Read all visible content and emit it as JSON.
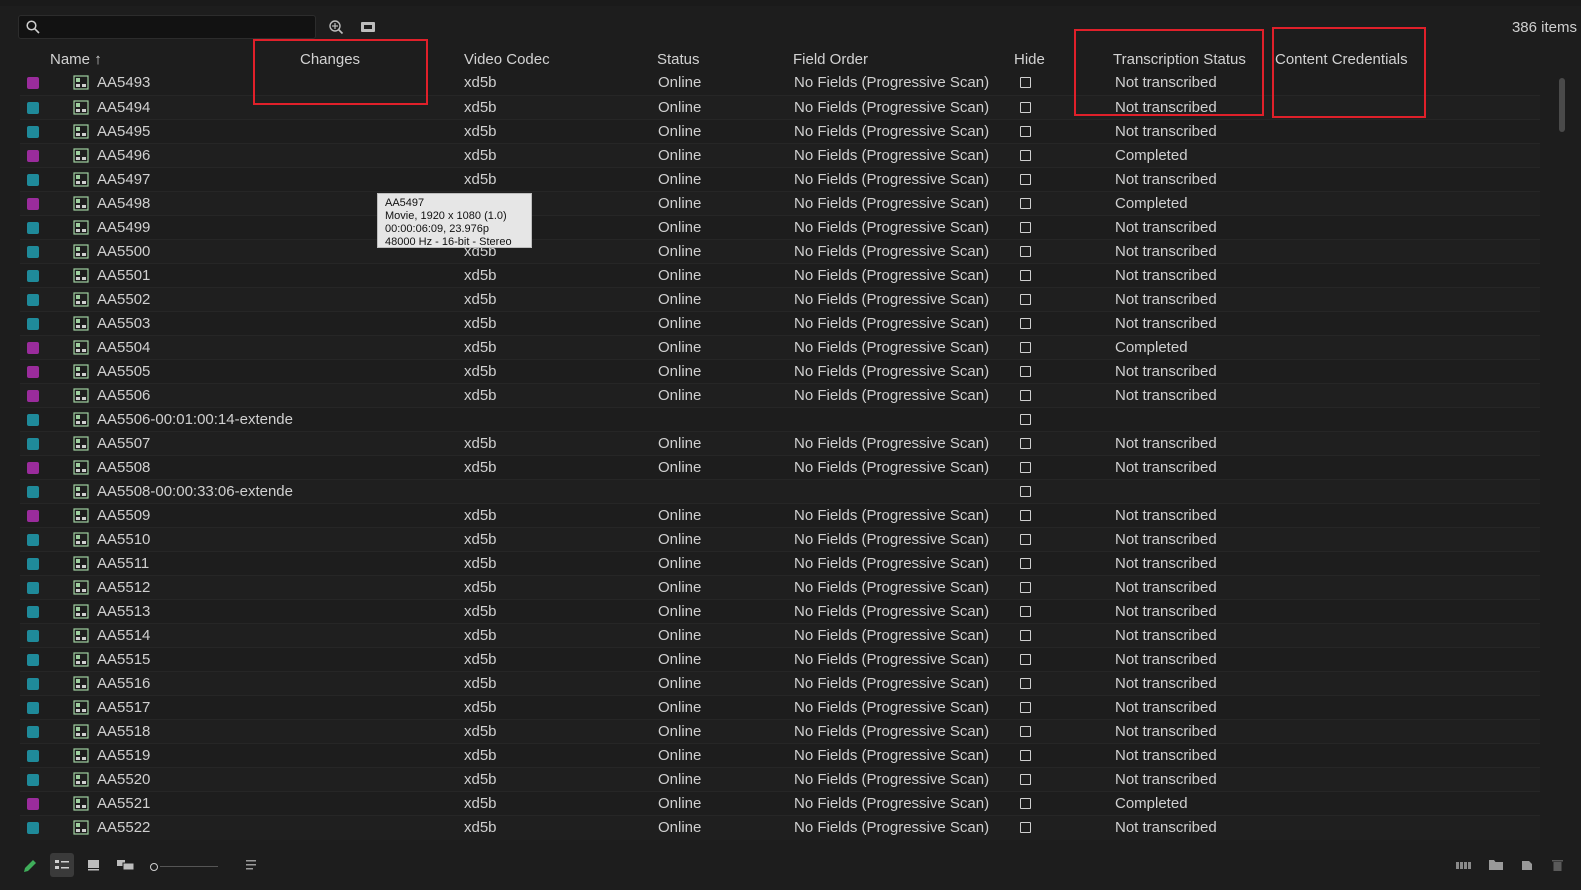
{
  "toolbar": {
    "search_value": "",
    "item_count": "386 items"
  },
  "columns": {
    "name": "Name",
    "changes": "Changes",
    "video_codec": "Video Codec",
    "status": "Status",
    "field_order": "Field Order",
    "hide": "Hide",
    "transcription_status": "Transcription Status",
    "content_credentials": "Content Credentials"
  },
  "colors": {
    "teal": "#1f8a9a",
    "magenta": "#9a2c9c",
    "highlight_box": "#e0202a"
  },
  "tooltip": {
    "line1": "AA5497",
    "line2": "Movie, 1920 x 1080 (1.0)",
    "line3": "00:00:06:09, 23.976p",
    "line4": "48000 Hz - 16-bit - Stereo"
  },
  "rows": [
    {
      "name": "AA5493",
      "label_color": "magenta",
      "codec": "xd5b",
      "status": "Online",
      "field_order": "No Fields (Progressive Scan)",
      "transcription": "Not transcribed"
    },
    {
      "name": "AA5494",
      "label_color": "teal",
      "codec": "xd5b",
      "status": "Online",
      "field_order": "No Fields (Progressive Scan)",
      "transcription": "Not transcribed"
    },
    {
      "name": "AA5495",
      "label_color": "teal",
      "codec": "xd5b",
      "status": "Online",
      "field_order": "No Fields (Progressive Scan)",
      "transcription": "Not transcribed"
    },
    {
      "name": "AA5496",
      "label_color": "magenta",
      "codec": "xd5b",
      "status": "Online",
      "field_order": "No Fields (Progressive Scan)",
      "transcription": "Completed"
    },
    {
      "name": "AA5497",
      "label_color": "teal",
      "codec": "xd5b",
      "status": "Online",
      "field_order": "No Fields (Progressive Scan)",
      "transcription": "Not transcribed"
    },
    {
      "name": "AA5498",
      "label_color": "magenta",
      "codec": "",
      "status": "Online",
      "field_order": "No Fields (Progressive Scan)",
      "transcription": "Completed"
    },
    {
      "name": "AA5499",
      "label_color": "teal",
      "codec": "",
      "status": "Online",
      "field_order": "No Fields (Progressive Scan)",
      "transcription": "Not transcribed"
    },
    {
      "name": "AA5500",
      "label_color": "teal",
      "codec": "xd5b",
      "status": "Online",
      "field_order": "No Fields (Progressive Scan)",
      "transcription": "Not transcribed"
    },
    {
      "name": "AA5501",
      "label_color": "teal",
      "codec": "xd5b",
      "status": "Online",
      "field_order": "No Fields (Progressive Scan)",
      "transcription": "Not transcribed"
    },
    {
      "name": "AA5502",
      "label_color": "teal",
      "codec": "xd5b",
      "status": "Online",
      "field_order": "No Fields (Progressive Scan)",
      "transcription": "Not transcribed"
    },
    {
      "name": "AA5503",
      "label_color": "teal",
      "codec": "xd5b",
      "status": "Online",
      "field_order": "No Fields (Progressive Scan)",
      "transcription": "Not transcribed"
    },
    {
      "name": "AA5504",
      "label_color": "magenta",
      "codec": "xd5b",
      "status": "Online",
      "field_order": "No Fields (Progressive Scan)",
      "transcription": "Completed"
    },
    {
      "name": "AA5505",
      "label_color": "magenta",
      "codec": "xd5b",
      "status": "Online",
      "field_order": "No Fields (Progressive Scan)",
      "transcription": "Not transcribed"
    },
    {
      "name": "AA5506",
      "label_color": "magenta",
      "codec": "xd5b",
      "status": "Online",
      "field_order": "No Fields (Progressive Scan)",
      "transcription": "Not transcribed"
    },
    {
      "name": "AA5506-00:01:00:14-extende",
      "label_color": "teal",
      "codec": "",
      "status": "",
      "field_order": "",
      "transcription": ""
    },
    {
      "name": "AA5507",
      "label_color": "teal",
      "codec": "xd5b",
      "status": "Online",
      "field_order": "No Fields (Progressive Scan)",
      "transcription": "Not transcribed"
    },
    {
      "name": "AA5508",
      "label_color": "magenta",
      "codec": "xd5b",
      "status": "Online",
      "field_order": "No Fields (Progressive Scan)",
      "transcription": "Not transcribed"
    },
    {
      "name": "AA5508-00:00:33:06-extende",
      "label_color": "teal",
      "codec": "",
      "status": "",
      "field_order": "",
      "transcription": ""
    },
    {
      "name": "AA5509",
      "label_color": "magenta",
      "codec": "xd5b",
      "status": "Online",
      "field_order": "No Fields (Progressive Scan)",
      "transcription": "Not transcribed"
    },
    {
      "name": "AA5510",
      "label_color": "teal",
      "codec": "xd5b",
      "status": "Online",
      "field_order": "No Fields (Progressive Scan)",
      "transcription": "Not transcribed"
    },
    {
      "name": "AA5511",
      "label_color": "teal",
      "codec": "xd5b",
      "status": "Online",
      "field_order": "No Fields (Progressive Scan)",
      "transcription": "Not transcribed"
    },
    {
      "name": "AA5512",
      "label_color": "teal",
      "codec": "xd5b",
      "status": "Online",
      "field_order": "No Fields (Progressive Scan)",
      "transcription": "Not transcribed"
    },
    {
      "name": "AA5513",
      "label_color": "teal",
      "codec": "xd5b",
      "status": "Online",
      "field_order": "No Fields (Progressive Scan)",
      "transcription": "Not transcribed"
    },
    {
      "name": "AA5514",
      "label_color": "teal",
      "codec": "xd5b",
      "status": "Online",
      "field_order": "No Fields (Progressive Scan)",
      "transcription": "Not transcribed"
    },
    {
      "name": "AA5515",
      "label_color": "teal",
      "codec": "xd5b",
      "status": "Online",
      "field_order": "No Fields (Progressive Scan)",
      "transcription": "Not transcribed"
    },
    {
      "name": "AA5516",
      "label_color": "teal",
      "codec": "xd5b",
      "status": "Online",
      "field_order": "No Fields (Progressive Scan)",
      "transcription": "Not transcribed"
    },
    {
      "name": "AA5517",
      "label_color": "teal",
      "codec": "xd5b",
      "status": "Online",
      "field_order": "No Fields (Progressive Scan)",
      "transcription": "Not transcribed"
    },
    {
      "name": "AA5518",
      "label_color": "teal",
      "codec": "xd5b",
      "status": "Online",
      "field_order": "No Fields (Progressive Scan)",
      "transcription": "Not transcribed"
    },
    {
      "name": "AA5519",
      "label_color": "teal",
      "codec": "xd5b",
      "status": "Online",
      "field_order": "No Fields (Progressive Scan)",
      "transcription": "Not transcribed"
    },
    {
      "name": "AA5520",
      "label_color": "teal",
      "codec": "xd5b",
      "status": "Online",
      "field_order": "No Fields (Progressive Scan)",
      "transcription": "Not transcribed"
    },
    {
      "name": "AA5521",
      "label_color": "magenta",
      "codec": "xd5b",
      "status": "Online",
      "field_order": "No Fields (Progressive Scan)",
      "transcription": "Completed"
    },
    {
      "name": "AA5522",
      "label_color": "teal",
      "codec": "xd5b",
      "status": "Online",
      "field_order": "No Fields (Progressive Scan)",
      "transcription": "Not transcribed"
    }
  ]
}
